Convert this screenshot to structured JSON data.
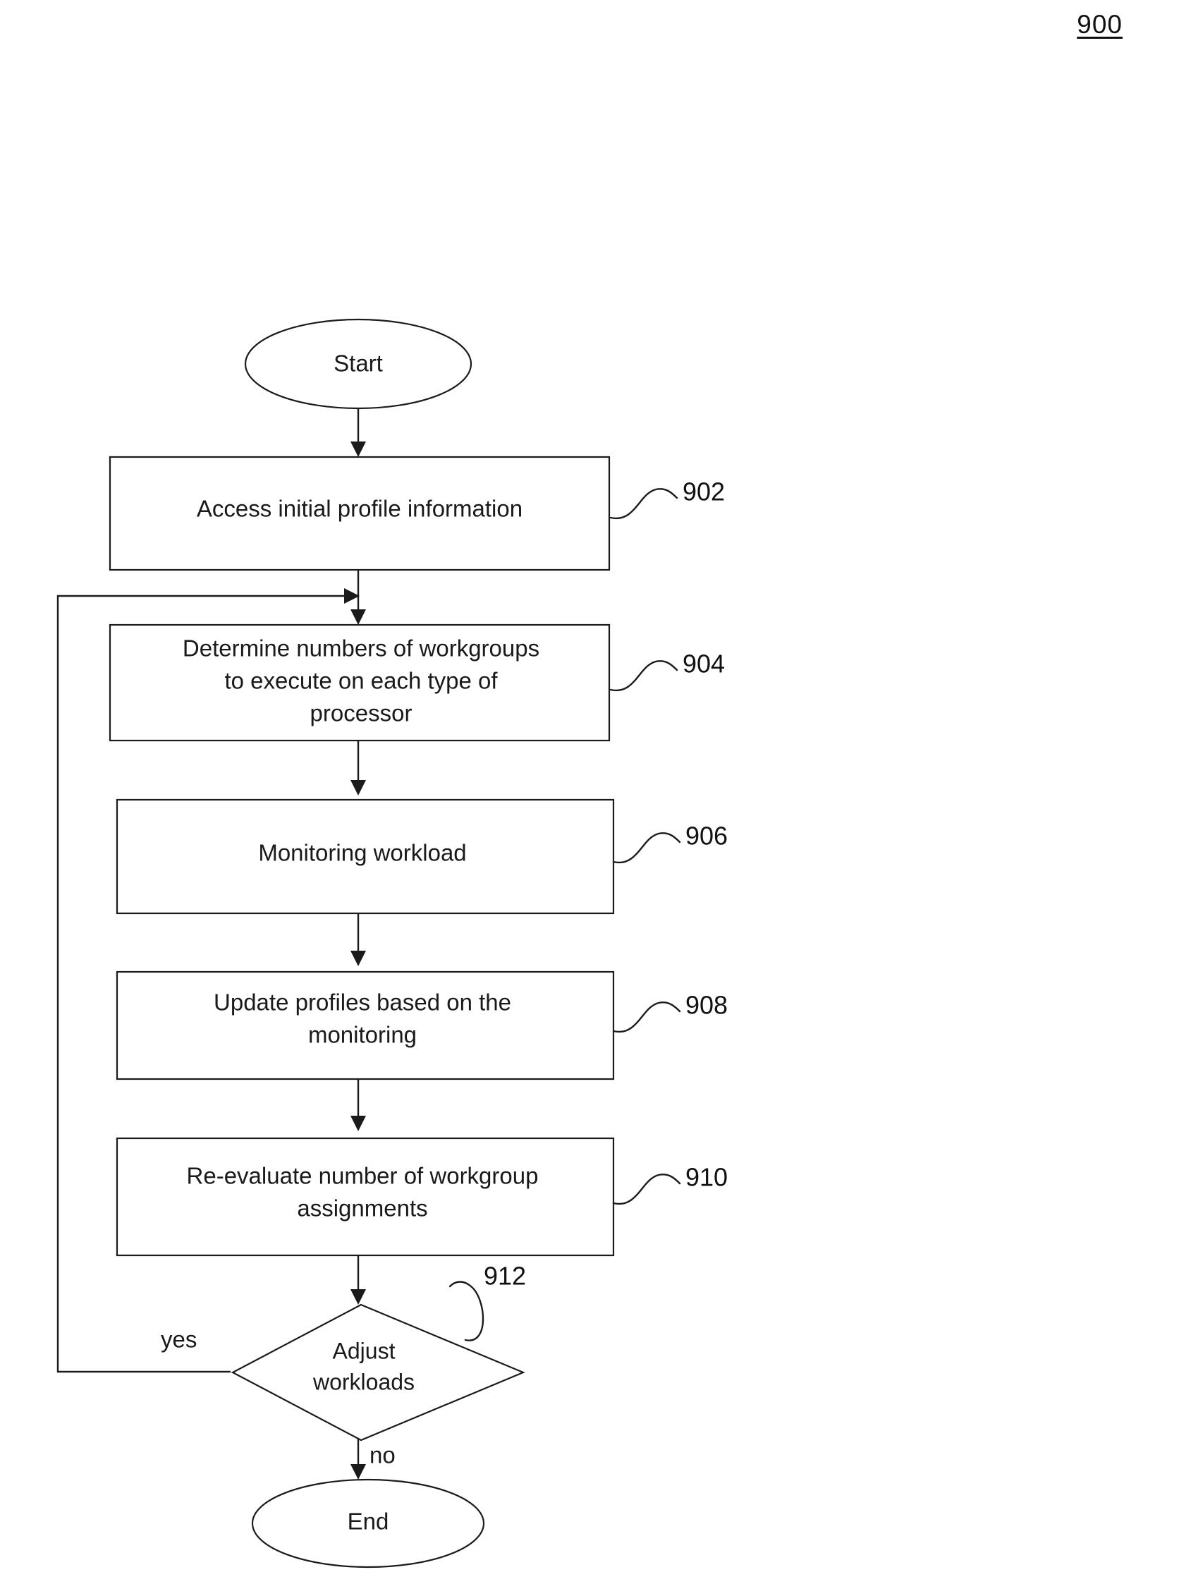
{
  "figure": {
    "number": "900",
    "type": "flowchart"
  },
  "nodes": {
    "start": {
      "label": "Start",
      "shape": "ellipse"
    },
    "step_902": {
      "label": "Access initial profile information",
      "ref": "902",
      "shape": "process"
    },
    "step_904": {
      "line1": "Determine numbers of workgroups",
      "line2": "to execute on each type of",
      "line3": "processor",
      "ref": "904",
      "shape": "process"
    },
    "step_906": {
      "label": "Monitoring workload",
      "ref": "906",
      "shape": "process"
    },
    "step_908": {
      "line1": "Update profiles based on the",
      "line2": "monitoring",
      "ref": "908",
      "shape": "process"
    },
    "step_910": {
      "line1": "Re-evaluate number of workgroup",
      "line2": "assignments",
      "ref": "910",
      "shape": "process"
    },
    "decision_912": {
      "line1": "Adjust",
      "line2": "workloads",
      "ref": "912",
      "shape": "diamond"
    },
    "end": {
      "label": "End",
      "shape": "ellipse"
    }
  },
  "edge_labels": {
    "yes": "yes",
    "no": "no"
  },
  "colors": {
    "ink": "#1b1b1b",
    "background": "#ffffff"
  }
}
